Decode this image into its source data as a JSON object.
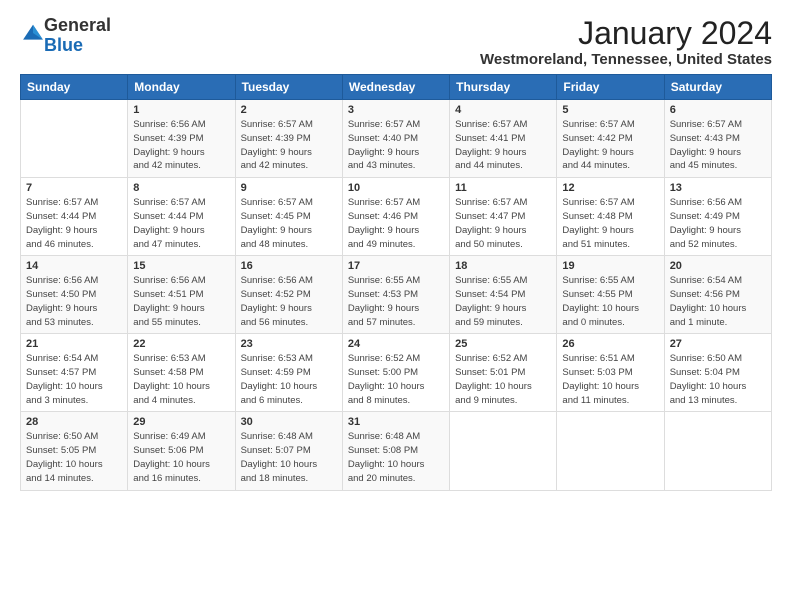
{
  "logo": {
    "general": "General",
    "blue": "Blue"
  },
  "title": "January 2024",
  "subtitle": "Westmoreland, Tennessee, United States",
  "headers": [
    "Sunday",
    "Monday",
    "Tuesday",
    "Wednesday",
    "Thursday",
    "Friday",
    "Saturday"
  ],
  "weeks": [
    [
      {
        "day": "",
        "info": ""
      },
      {
        "day": "1",
        "info": "Sunrise: 6:56 AM\nSunset: 4:39 PM\nDaylight: 9 hours\nand 42 minutes."
      },
      {
        "day": "2",
        "info": "Sunrise: 6:57 AM\nSunset: 4:39 PM\nDaylight: 9 hours\nand 42 minutes."
      },
      {
        "day": "3",
        "info": "Sunrise: 6:57 AM\nSunset: 4:40 PM\nDaylight: 9 hours\nand 43 minutes."
      },
      {
        "day": "4",
        "info": "Sunrise: 6:57 AM\nSunset: 4:41 PM\nDaylight: 9 hours\nand 44 minutes."
      },
      {
        "day": "5",
        "info": "Sunrise: 6:57 AM\nSunset: 4:42 PM\nDaylight: 9 hours\nand 44 minutes."
      },
      {
        "day": "6",
        "info": "Sunrise: 6:57 AM\nSunset: 4:43 PM\nDaylight: 9 hours\nand 45 minutes."
      }
    ],
    [
      {
        "day": "7",
        "info": "Sunrise: 6:57 AM\nSunset: 4:44 PM\nDaylight: 9 hours\nand 46 minutes."
      },
      {
        "day": "8",
        "info": "Sunrise: 6:57 AM\nSunset: 4:44 PM\nDaylight: 9 hours\nand 47 minutes."
      },
      {
        "day": "9",
        "info": "Sunrise: 6:57 AM\nSunset: 4:45 PM\nDaylight: 9 hours\nand 48 minutes."
      },
      {
        "day": "10",
        "info": "Sunrise: 6:57 AM\nSunset: 4:46 PM\nDaylight: 9 hours\nand 49 minutes."
      },
      {
        "day": "11",
        "info": "Sunrise: 6:57 AM\nSunset: 4:47 PM\nDaylight: 9 hours\nand 50 minutes."
      },
      {
        "day": "12",
        "info": "Sunrise: 6:57 AM\nSunset: 4:48 PM\nDaylight: 9 hours\nand 51 minutes."
      },
      {
        "day": "13",
        "info": "Sunrise: 6:56 AM\nSunset: 4:49 PM\nDaylight: 9 hours\nand 52 minutes."
      }
    ],
    [
      {
        "day": "14",
        "info": "Sunrise: 6:56 AM\nSunset: 4:50 PM\nDaylight: 9 hours\nand 53 minutes."
      },
      {
        "day": "15",
        "info": "Sunrise: 6:56 AM\nSunset: 4:51 PM\nDaylight: 9 hours\nand 55 minutes."
      },
      {
        "day": "16",
        "info": "Sunrise: 6:56 AM\nSunset: 4:52 PM\nDaylight: 9 hours\nand 56 minutes."
      },
      {
        "day": "17",
        "info": "Sunrise: 6:55 AM\nSunset: 4:53 PM\nDaylight: 9 hours\nand 57 minutes."
      },
      {
        "day": "18",
        "info": "Sunrise: 6:55 AM\nSunset: 4:54 PM\nDaylight: 9 hours\nand 59 minutes."
      },
      {
        "day": "19",
        "info": "Sunrise: 6:55 AM\nSunset: 4:55 PM\nDaylight: 10 hours\nand 0 minutes."
      },
      {
        "day": "20",
        "info": "Sunrise: 6:54 AM\nSunset: 4:56 PM\nDaylight: 10 hours\nand 1 minute."
      }
    ],
    [
      {
        "day": "21",
        "info": "Sunrise: 6:54 AM\nSunset: 4:57 PM\nDaylight: 10 hours\nand 3 minutes."
      },
      {
        "day": "22",
        "info": "Sunrise: 6:53 AM\nSunset: 4:58 PM\nDaylight: 10 hours\nand 4 minutes."
      },
      {
        "day": "23",
        "info": "Sunrise: 6:53 AM\nSunset: 4:59 PM\nDaylight: 10 hours\nand 6 minutes."
      },
      {
        "day": "24",
        "info": "Sunrise: 6:52 AM\nSunset: 5:00 PM\nDaylight: 10 hours\nand 8 minutes."
      },
      {
        "day": "25",
        "info": "Sunrise: 6:52 AM\nSunset: 5:01 PM\nDaylight: 10 hours\nand 9 minutes."
      },
      {
        "day": "26",
        "info": "Sunrise: 6:51 AM\nSunset: 5:03 PM\nDaylight: 10 hours\nand 11 minutes."
      },
      {
        "day": "27",
        "info": "Sunrise: 6:50 AM\nSunset: 5:04 PM\nDaylight: 10 hours\nand 13 minutes."
      }
    ],
    [
      {
        "day": "28",
        "info": "Sunrise: 6:50 AM\nSunset: 5:05 PM\nDaylight: 10 hours\nand 14 minutes."
      },
      {
        "day": "29",
        "info": "Sunrise: 6:49 AM\nSunset: 5:06 PM\nDaylight: 10 hours\nand 16 minutes."
      },
      {
        "day": "30",
        "info": "Sunrise: 6:48 AM\nSunset: 5:07 PM\nDaylight: 10 hours\nand 18 minutes."
      },
      {
        "day": "31",
        "info": "Sunrise: 6:48 AM\nSunset: 5:08 PM\nDaylight: 10 hours\nand 20 minutes."
      },
      {
        "day": "",
        "info": ""
      },
      {
        "day": "",
        "info": ""
      },
      {
        "day": "",
        "info": ""
      }
    ]
  ]
}
